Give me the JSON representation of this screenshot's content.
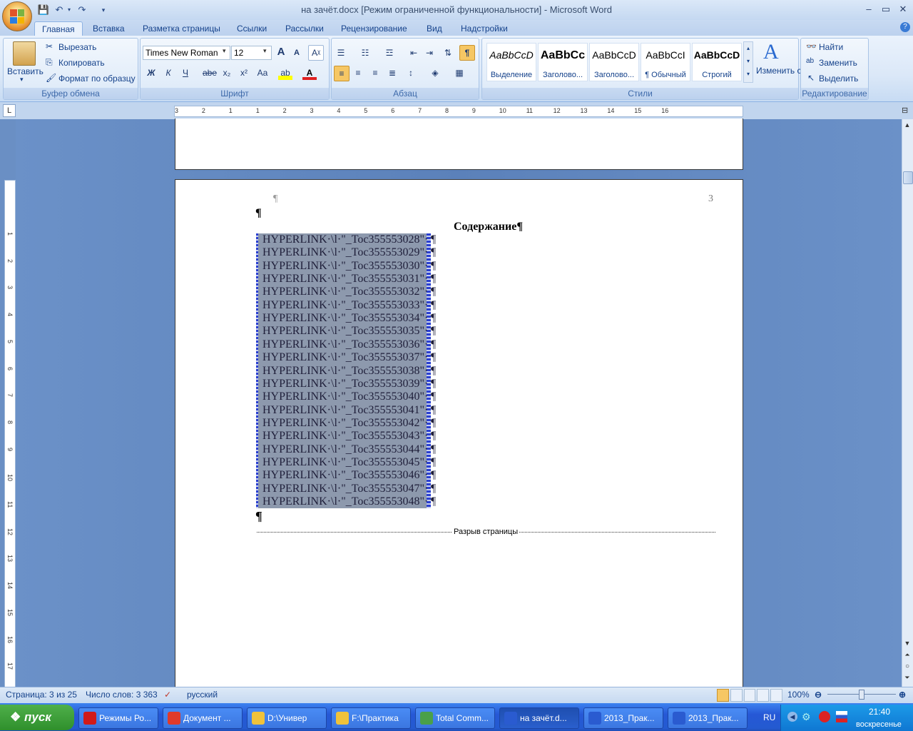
{
  "window": {
    "title": "на зачёт.docx [Режим ограниченной функциональности] - Microsoft Word",
    "controls": [
      "–",
      "▭",
      "✕"
    ]
  },
  "tabs": [
    "Главная",
    "Вставка",
    "Разметка страницы",
    "Ссылки",
    "Рассылки",
    "Рецензирование",
    "Вид",
    "Надстройки"
  ],
  "ribbon": {
    "clipboard": {
      "paste": "Вставить",
      "cut": "Вырезать",
      "copy": "Копировать",
      "format_painter": "Формат по образцу",
      "label": "Буфер обмена"
    },
    "font": {
      "name": "Times New Roman",
      "size": "12",
      "bold": "Ж",
      "italic": "К",
      "underline": "Ч",
      "strike": "abe",
      "sub": "x₂",
      "sup": "x²",
      "case": "Aa",
      "grow": "A",
      "shrink": "A",
      "label": "Шрифт"
    },
    "paragraph": {
      "label": "Абзац",
      "pilcrow": "¶"
    },
    "styles": {
      "items": [
        {
          "preview": "AaBbCcD",
          "name": "Выделение"
        },
        {
          "preview": "AaBbCc",
          "name": "Заголово..."
        },
        {
          "preview": "AaBbCcD",
          "name": "Заголово..."
        },
        {
          "preview": "AaBbCcI",
          "name": "¶ Обычный"
        },
        {
          "preview": "AaBbCcD",
          "name": "Строгий"
        }
      ],
      "change": "Изменить стили",
      "label": "Стили"
    },
    "editing": {
      "find": "Найти",
      "replace": "Заменить",
      "select": "Выделить",
      "label": "Редактирование"
    }
  },
  "ruler": {
    "h_ticks": [
      "3",
      "2",
      "1",
      "1",
      "2",
      "3",
      "4",
      "5",
      "6",
      "7",
      "8",
      "9",
      "10",
      "11",
      "12",
      "13",
      "14",
      "15",
      "16"
    ],
    "v_ticks": [
      "1",
      "2",
      "3",
      "4",
      "5",
      "6",
      "7",
      "8",
      "9",
      "10",
      "11",
      "12",
      "13",
      "14",
      "15",
      "16",
      "17"
    ]
  },
  "document": {
    "page_number": "3",
    "pilcrow": "¶",
    "heading": "Содержание¶",
    "toc_lines": [
      "HYPERLINK·\\l·\"_Toc355553028\"·",
      "HYPERLINK·\\l·\"_Toc355553029\"·",
      "HYPERLINK·\\l·\"_Toc355553030\"·",
      "HYPERLINK·\\l·\"_Toc355553031\"·",
      "HYPERLINK·\\l·\"_Toc355553032\"·",
      "HYPERLINK·\\l·\"_Toc355553033\"·",
      "HYPERLINK·\\l·\"_Toc355553034\"·",
      "HYPERLINK·\\l·\"_Toc355553035\"·",
      "HYPERLINK·\\l·\"_Toc355553036\"·",
      "HYPERLINK·\\l·\"_Toc355553037\"·",
      "HYPERLINK·\\l·\"_Toc355553038\"·",
      "HYPERLINK·\\l·\"_Toc355553039\"·",
      "HYPERLINK·\\l·\"_Toc355553040\"·",
      "HYPERLINK·\\l·\"_Toc355553041\"·",
      "HYPERLINK·\\l·\"_Toc355553042\"·",
      "HYPERLINK·\\l·\"_Toc355553043\"·",
      "HYPERLINK·\\l·\"_Toc355553044\"·",
      "HYPERLINK·\\l·\"_Toc355553045\"·",
      "HYPERLINK·\\l·\"_Toc355553046\"·",
      "HYPERLINK·\\l·\"_Toc355553047\"·",
      "HYPERLINK·\\l·\"_Toc355553048\"·"
    ],
    "page_break": "Разрыв страницы"
  },
  "status": {
    "page": "Страница: 3 из 25",
    "words": "Число слов: 3 363",
    "language": "русский",
    "zoom": "100%"
  },
  "taskbar": {
    "start": "пуск",
    "tasks": [
      {
        "label": "Режимы Ро...",
        "color": "#d11a1a"
      },
      {
        "label": "Документ ...",
        "color": "#e03a2a"
      },
      {
        "label": "D:\\Универ",
        "color": "#f0c23a"
      },
      {
        "label": "F:\\Практика",
        "color": "#f0c23a"
      },
      {
        "label": "Total Comm...",
        "color": "#4aa04a"
      },
      {
        "label": "на зачёт.d...",
        "color": "#2a5bd0"
      },
      {
        "label": "2013_Прак...",
        "color": "#2a5bd0"
      },
      {
        "label": "2013_Прак...",
        "color": "#2a5bd0"
      }
    ],
    "lang": "RU",
    "time": "21:40",
    "day": "воскресенье"
  }
}
